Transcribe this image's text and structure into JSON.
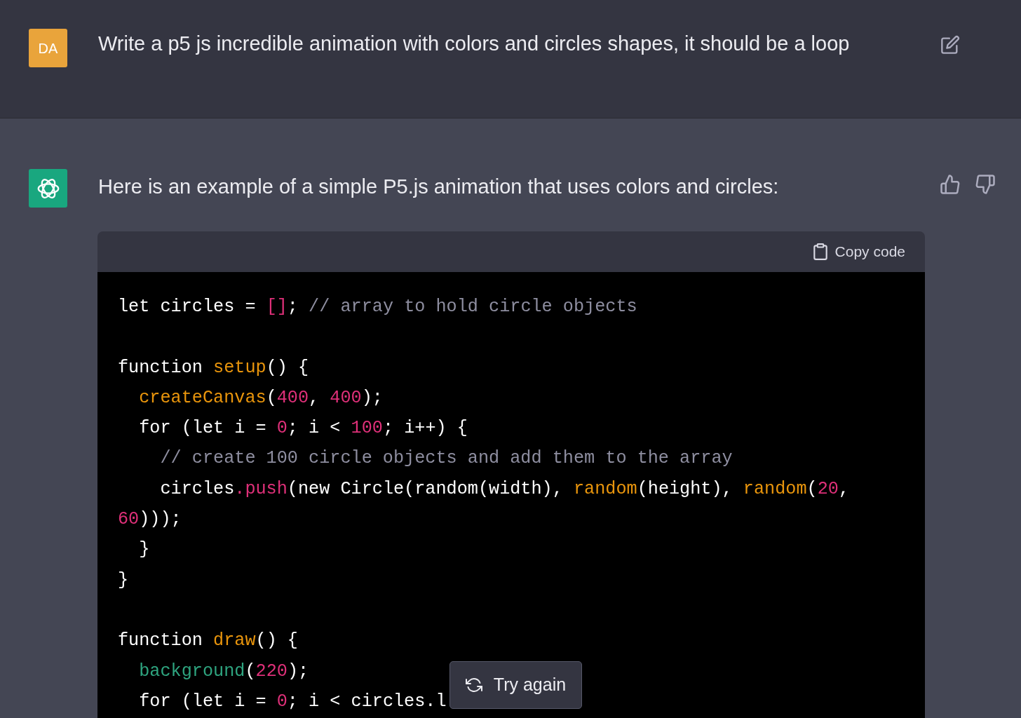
{
  "user_message": {
    "avatar": "DA",
    "text": "Write a p5 js incredible animation with colors and circles shapes, it should be a loop"
  },
  "assistant_message": {
    "text": "Here is an example of a simple P5.js animation that uses colors and circles:",
    "code_block": {
      "copy_label": "Copy code",
      "lines": [
        {
          "kind": "code",
          "tokens": [
            {
              "kind": "plain",
              "text": "let circles = "
            },
            {
              "kind": "number",
              "text": "[]"
            },
            {
              "kind": "plain",
              "text": "; "
            },
            {
              "kind": "comment",
              "text": "// array to hold circle objects"
            }
          ]
        },
        {
          "kind": "blank"
        },
        {
          "kind": "code",
          "tokens": [
            {
              "kind": "plain",
              "text": "function "
            },
            {
              "kind": "function",
              "text": "setup"
            },
            {
              "kind": "plain",
              "text": "() {"
            }
          ]
        },
        {
          "kind": "code",
          "tokens": [
            {
              "kind": "function",
              "text": "  createCanvas"
            },
            {
              "kind": "plain",
              "text": "("
            },
            {
              "kind": "number",
              "text": "400"
            },
            {
              "kind": "plain",
              "text": ", "
            },
            {
              "kind": "number",
              "text": "400"
            },
            {
              "kind": "plain",
              "text": ");"
            }
          ]
        },
        {
          "kind": "code",
          "tokens": [
            {
              "kind": "plain",
              "text": "  for (let i = "
            },
            {
              "kind": "number",
              "text": "0"
            },
            {
              "kind": "plain",
              "text": "; i < "
            },
            {
              "kind": "number",
              "text": "100"
            },
            {
              "kind": "plain",
              "text": "; i++) {"
            }
          ]
        },
        {
          "kind": "code",
          "tokens": [
            {
              "kind": "comment",
              "text": "    // create 100 circle objects and add them to the array"
            }
          ]
        },
        {
          "kind": "code",
          "tokens": [
            {
              "kind": "plain",
              "text": "    circles"
            },
            {
              "kind": "number",
              "text": ".push"
            },
            {
              "kind": "plain",
              "text": "(new Circle(random(width), "
            },
            {
              "kind": "function",
              "text": "random"
            },
            {
              "kind": "plain",
              "text": "(height), "
            },
            {
              "kind": "function",
              "text": "random"
            },
            {
              "kind": "plain",
              "text": "("
            },
            {
              "kind": "number",
              "text": "20"
            },
            {
              "kind": "plain",
              "text": ","
            }
          ]
        },
        {
          "kind": "code",
          "tokens": [
            {
              "kind": "number",
              "text": "60"
            },
            {
              "kind": "plain",
              "text": ")));"
            }
          ]
        },
        {
          "kind": "code",
          "tokens": [
            {
              "kind": "plain",
              "text": "  }"
            }
          ]
        },
        {
          "kind": "code",
          "tokens": [
            {
              "kind": "plain",
              "text": "}"
            }
          ]
        },
        {
          "kind": "blank"
        },
        {
          "kind": "code",
          "tokens": [
            {
              "kind": "plain",
              "text": "function "
            },
            {
              "kind": "function",
              "text": "draw"
            },
            {
              "kind": "plain",
              "text": "() {"
            }
          ]
        },
        {
          "kind": "code",
          "tokens": [
            {
              "kind": "builtin",
              "text": "  background"
            },
            {
              "kind": "plain",
              "text": "("
            },
            {
              "kind": "number",
              "text": "220"
            },
            {
              "kind": "plain",
              "text": ");"
            }
          ]
        },
        {
          "kind": "code",
          "tokens": [
            {
              "kind": "plain",
              "text": "  for (let i = "
            },
            {
              "kind": "number",
              "text": "0"
            },
            {
              "kind": "plain",
              "text": "; i < circles.l"
            }
          ]
        }
      ]
    }
  },
  "retry_button": {
    "label": "Try again"
  }
}
